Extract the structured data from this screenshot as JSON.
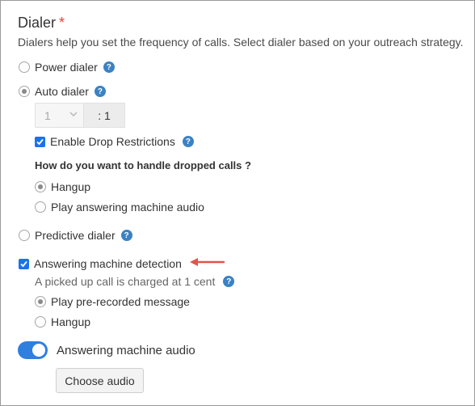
{
  "section": {
    "title": "Dialer",
    "required_mark": "*",
    "description": "Dialers help you set the frequency of calls. Select dialer based on your outreach strategy."
  },
  "dialers": {
    "power": {
      "label": "Power dialer",
      "selected": false
    },
    "auto": {
      "label": "Auto dialer",
      "selected": true
    },
    "predictive": {
      "label": "Predictive dialer",
      "selected": false
    }
  },
  "auto_settings": {
    "lines_value": "1",
    "ratio_label": ": 1",
    "drop_restrictions_label": "Enable Drop Restrictions",
    "drop_restrictions_checked": true,
    "dropped_question": "How do you want to handle dropped calls ?",
    "dropped_options": [
      {
        "label": "Hangup",
        "selected": true
      },
      {
        "label": "Play answering machine audio",
        "selected": false
      }
    ]
  },
  "amd": {
    "label": "Answering machine detection",
    "checked": true,
    "charge_note": "A picked up call is charged at 1 cent",
    "options": [
      {
        "label": "Play pre-recorded message",
        "selected": true
      },
      {
        "label": "Hangup",
        "selected": false
      }
    ]
  },
  "audio": {
    "toggle_label": "Answering machine audio",
    "toggle_on": true,
    "choose_button": "Choose audio"
  },
  "colors": {
    "accent": "#2f7fde",
    "help_icon": "#3b82c4",
    "required": "#e0433c",
    "annotation_arrow": "#e0544b"
  }
}
